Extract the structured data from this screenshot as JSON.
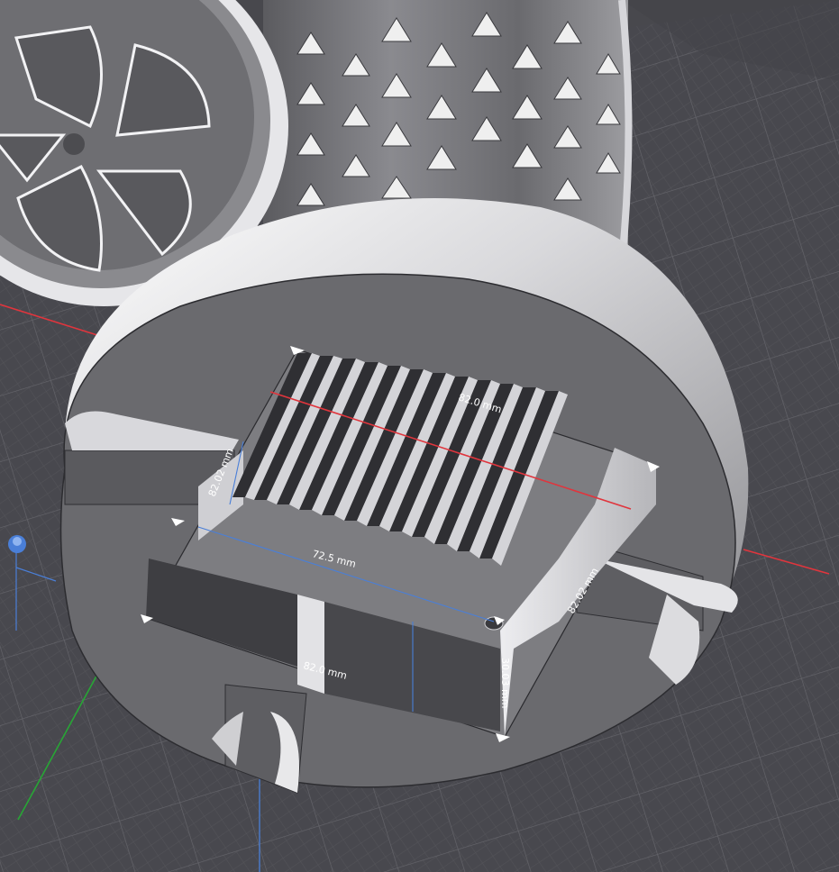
{
  "viewport": {
    "background": "#48484d",
    "grid_color": "#6b6b72",
    "grid_minor_color": "#58585e"
  },
  "axes": {
    "x_axis_color": "#e0353d",
    "y_axis_color": "#27a635",
    "z_axis_color": "#4a7fd8"
  },
  "dimensions": {
    "top_length": "82.0 mm",
    "side_depth": "82.02 mm",
    "inner_width": "72.5 mm",
    "right_depth": "82.02 mm",
    "front_length": "82.0 mm",
    "height": "30.03 mm"
  },
  "widgets": {
    "gizmo": "origin-gizmo-icon",
    "handles": "resize-handle-icon"
  }
}
